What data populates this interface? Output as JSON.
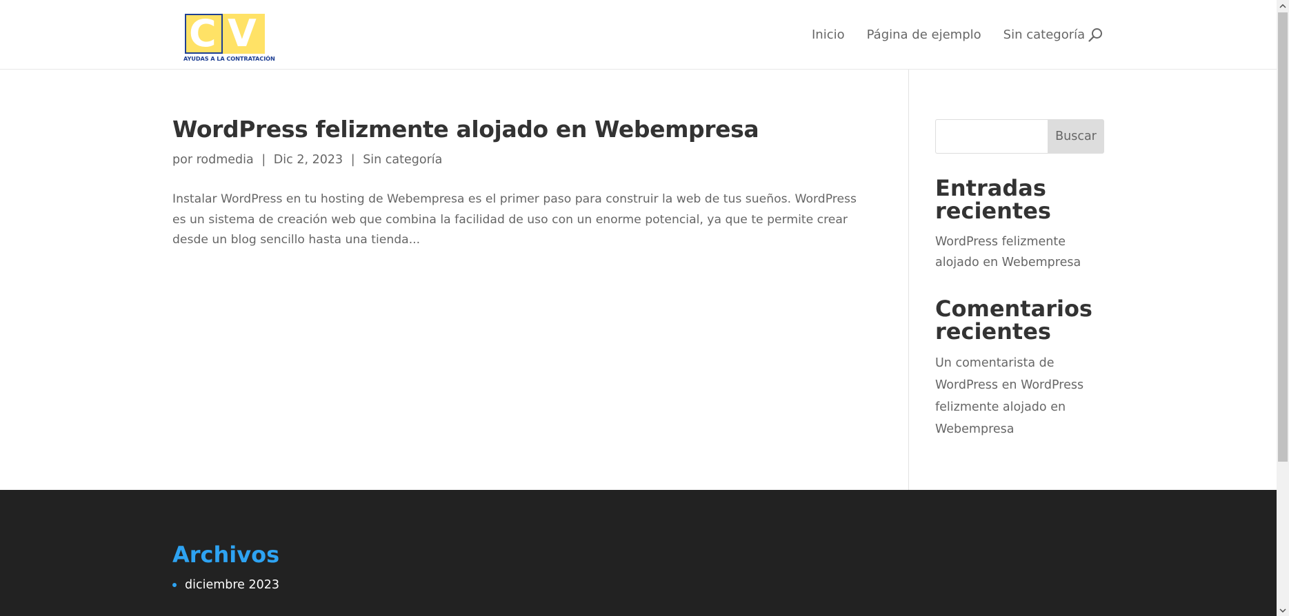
{
  "header": {
    "logo": {
      "letter_c": "C",
      "letter_v": "V",
      "tagline": "AYUDAS A LA CONTRATACIÓN",
      "yellow": "#ffe266",
      "blue": "#1e3f93"
    },
    "nav": [
      {
        "label": "Inicio"
      },
      {
        "label": "Página de ejemplo"
      },
      {
        "label": "Sin categoría"
      }
    ],
    "search_icon": "search-icon"
  },
  "post": {
    "title": "WordPress felizmente alojado en Webempresa",
    "meta": {
      "prefix": "por",
      "author": "rodmedia",
      "separator": "|",
      "date": "Dic 2, 2023",
      "category": "Sin categoría"
    },
    "excerpt": "Instalar WordPress en tu hosting de Webempresa es el primer paso para construir la web de tus sueños. WordPress es un sistema de creación web que combina la facilidad de uso con un enorme potencial, ya que te permite crear desde un blog sencillo hasta una tienda..."
  },
  "sidebar": {
    "search": {
      "value": "",
      "placeholder": "",
      "button_label": "Buscar"
    },
    "recent_posts": {
      "title": "Entradas recientes",
      "items": [
        "WordPress felizmente alojado en Webempresa"
      ]
    },
    "recent_comments": {
      "title": "Comentarios recientes",
      "author": "Un comentarista de WordPress",
      "connector": "en",
      "post": "WordPress felizmente alojado en Webempresa"
    }
  },
  "footer": {
    "archives_title": "Archivos",
    "archives": [
      "diciembre 2023"
    ],
    "accent": "#2ea3f2",
    "background": "#222222"
  }
}
